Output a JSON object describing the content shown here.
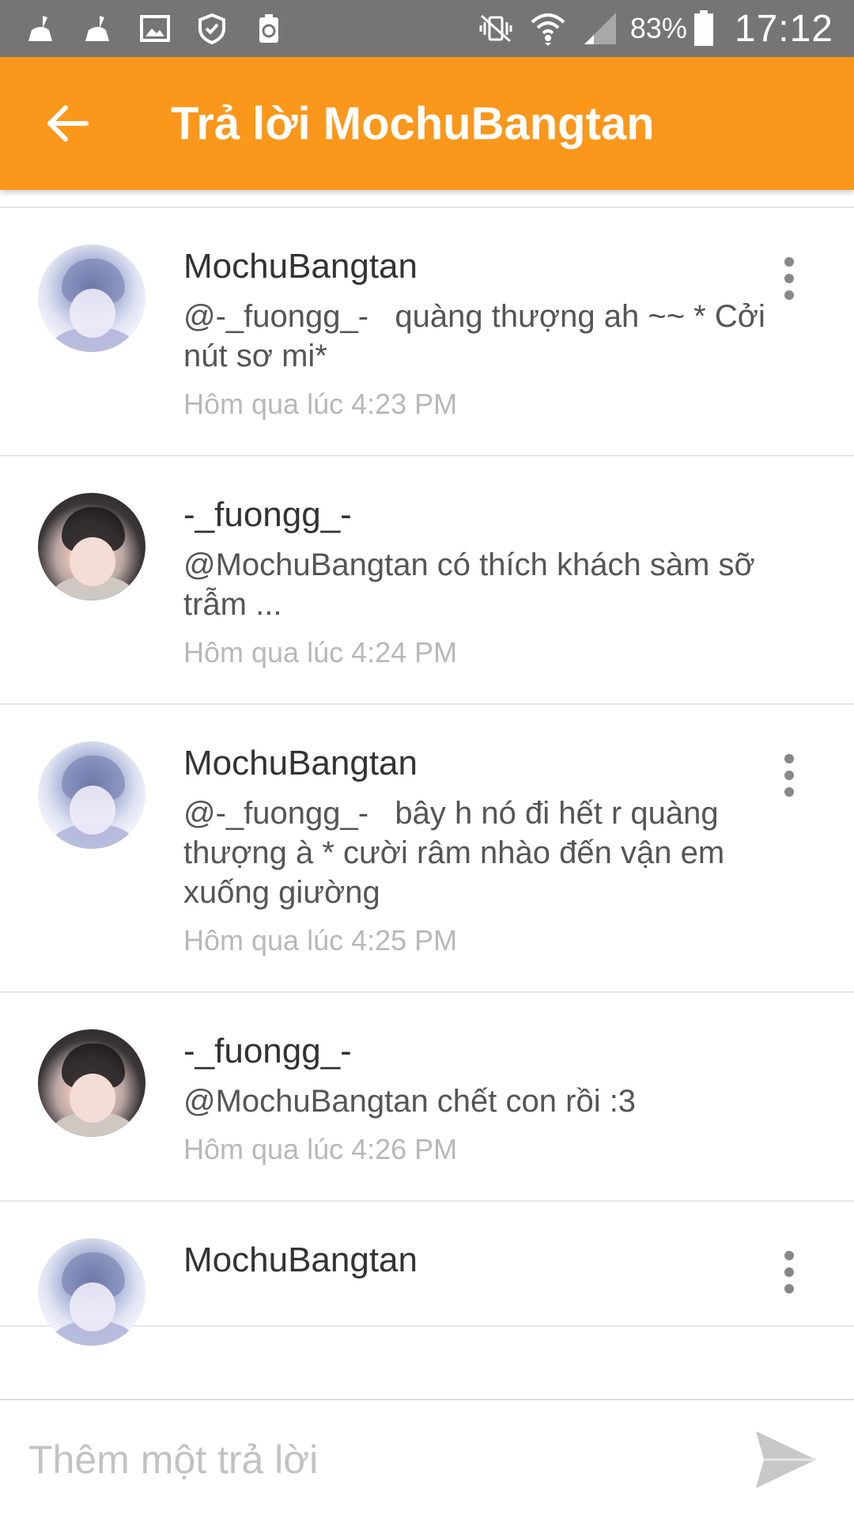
{
  "status_bar": {
    "battery_percent": "83%",
    "time": "17:12",
    "left_icons": [
      "cleaner-icon",
      "cleaner-icon",
      "image-icon",
      "shield-icon",
      "recycle-battery-icon"
    ],
    "right_icons": [
      "vibrate-mute-icon",
      "wifi-icon",
      "signal-icon",
      "battery-icon"
    ]
  },
  "app_bar": {
    "title": "Trả lời MochuBangtan",
    "color": "#fb971b"
  },
  "comments": [
    {
      "username": "MochuBangtan",
      "message": "@-_fuongg_-   quàng thượng ah ~~ * Cởi nút sơ mi*",
      "timestamp": "Hôm qua lúc 4:23 PM",
      "has_menu": true
    },
    {
      "username": "-_fuongg_-",
      "message": "@MochuBangtan có thích khách sàm sỡ trẫm ...",
      "timestamp": "Hôm qua lúc 4:24 PM",
      "has_menu": false
    },
    {
      "username": "MochuBangtan",
      "message": "@-_fuongg_-   bây h nó đi hết r quàng thượng à * cười râm nhào đến vận em xuống giường",
      "timestamp": "Hôm qua lúc 4:25 PM",
      "has_menu": true
    },
    {
      "username": "-_fuongg_-",
      "message": "@MochuBangtan chết con rồi :3",
      "timestamp": "Hôm qua lúc 4:26 PM",
      "has_menu": false
    },
    {
      "username": "MochuBangtan",
      "message": "",
      "timestamp": "",
      "has_menu": true
    }
  ],
  "reply": {
    "placeholder": "Thêm một trả lời",
    "value": ""
  }
}
